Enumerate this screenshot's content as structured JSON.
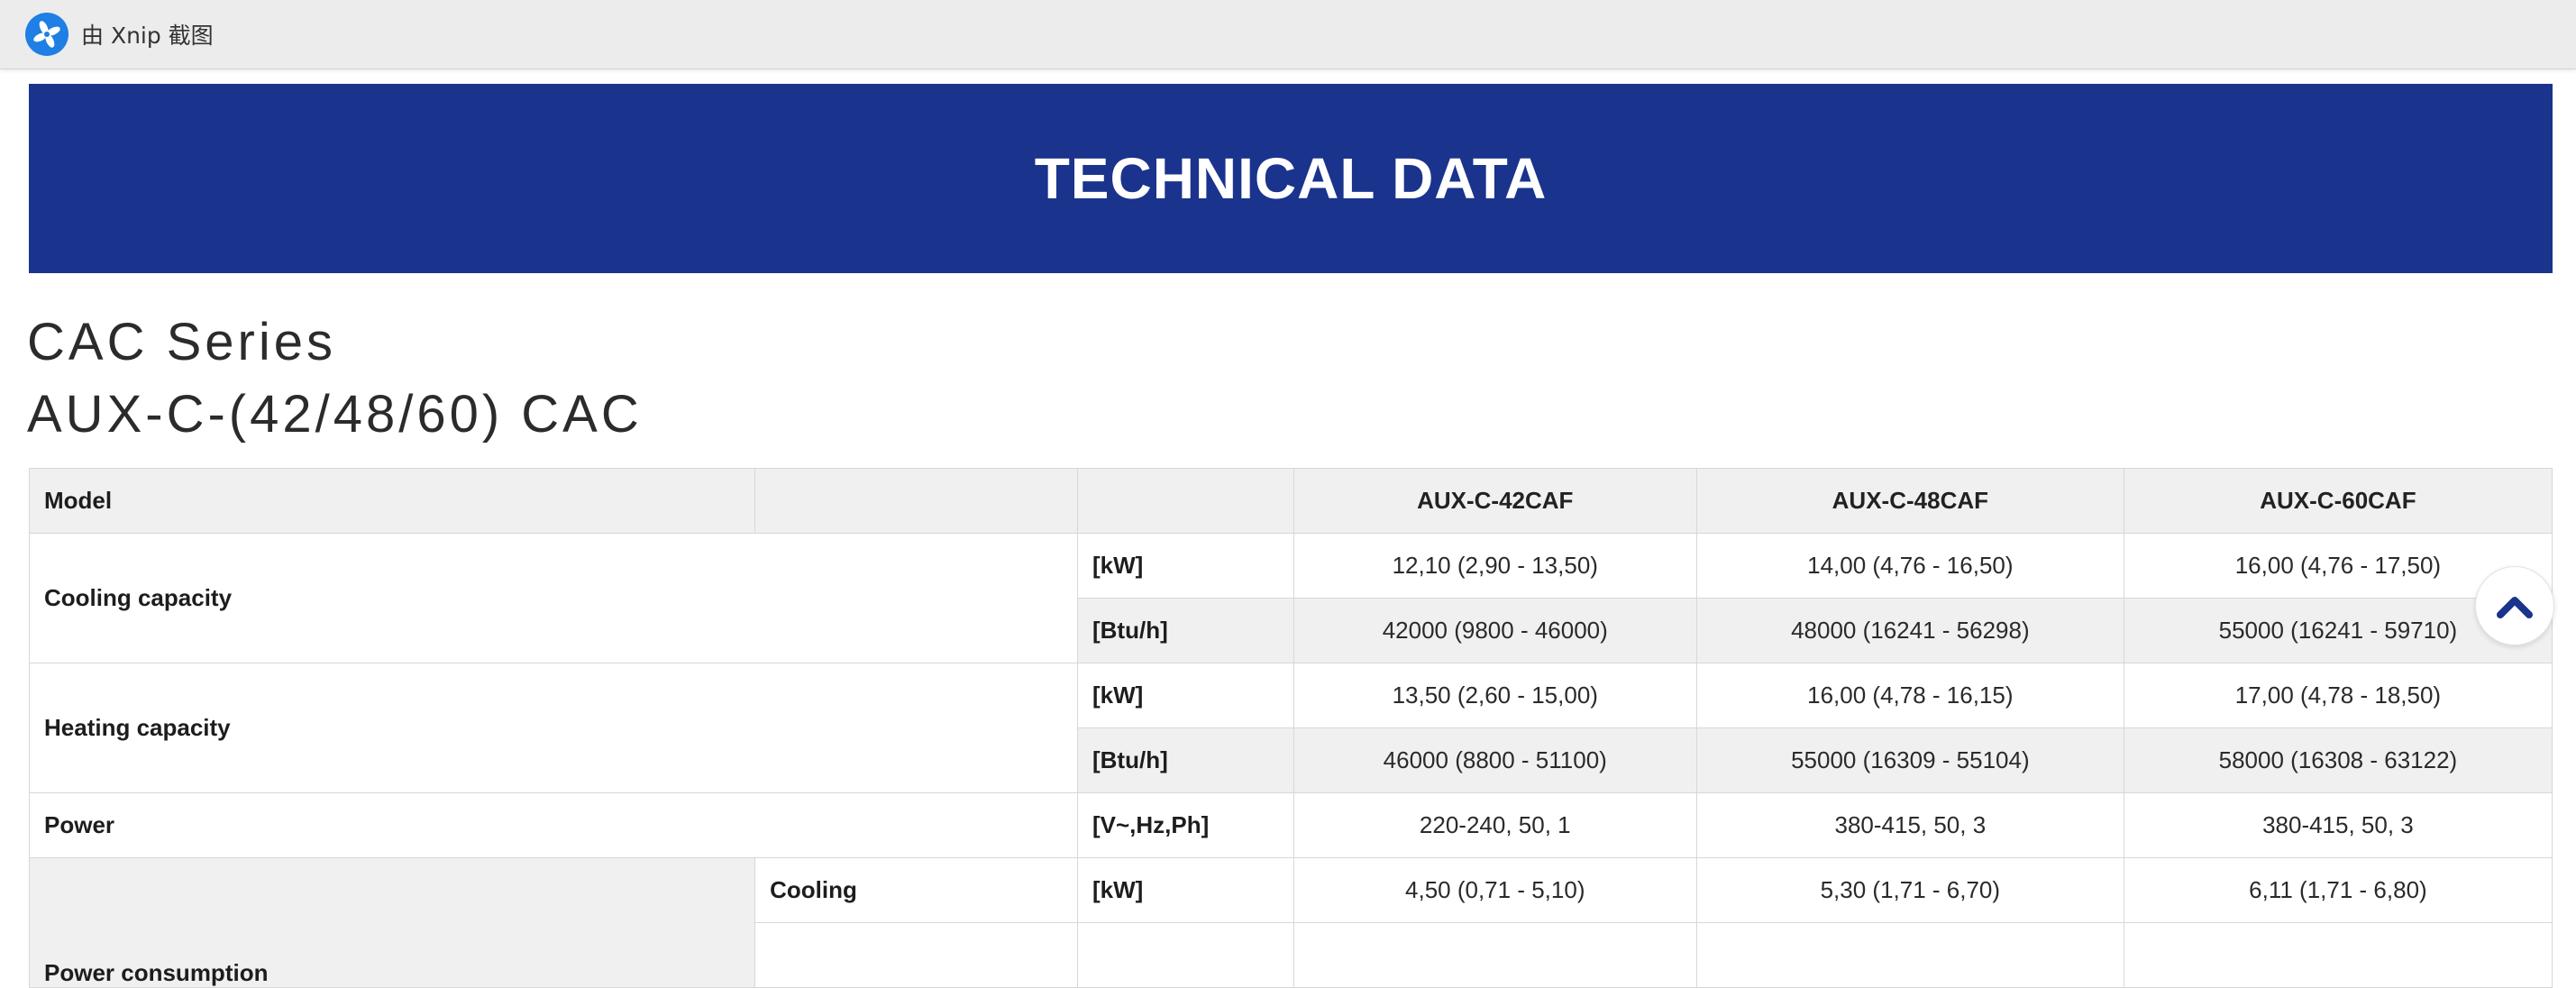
{
  "window": {
    "label": "由 Xnip 截图",
    "icon": "xnip-app-icon"
  },
  "banner": {
    "title": "TECHNICAL DATA",
    "color": "#1a338c"
  },
  "series": {
    "line1": "CAC Series",
    "line2": "AUX-C-(42/48/60) CAC"
  },
  "table": {
    "header": {
      "model_label": "Model",
      "models": [
        "AUX-C-42CAF",
        "AUX-C-48CAF",
        "AUX-C-60CAF"
      ]
    },
    "cooling": {
      "label": "Cooling capacity",
      "rows": [
        {
          "unit": "[kW]",
          "values": [
            "12,10 (2,90 - 13,50)",
            "14,00 (4,76 - 16,50)",
            "16,00 (4,76 - 17,50)"
          ]
        },
        {
          "unit": "[Btu/h]",
          "values": [
            "42000 (9800 - 46000)",
            "48000 (16241 - 56298)",
            "55000 (16241 - 59710)"
          ]
        }
      ]
    },
    "heating": {
      "label": "Heating capacity",
      "rows": [
        {
          "unit": "[kW]",
          "values": [
            "13,50 (2,60 - 15,00)",
            "16,00 (4,78 - 16,15)",
            "17,00 (4,78 - 18,50)"
          ]
        },
        {
          "unit": "[Btu/h]",
          "values": [
            "46000 (8800 - 51100)",
            "55000 (16309 - 55104)",
            "58000 (16308 - 63122)"
          ]
        }
      ]
    },
    "power": {
      "label": "Power",
      "unit": "[V~,Hz,Ph]",
      "values": [
        "220-240, 50, 1",
        "380-415, 50, 3",
        "380-415, 50, 3"
      ]
    },
    "power_consumption": {
      "label": "Power consumption",
      "sub_label": "Cooling",
      "unit": "[kW]",
      "values": [
        "4,50 (0,71 - 5,10)",
        "5,30 (1,71 - 6,70)",
        "6,11 (1,71 - 6,80)"
      ]
    }
  },
  "scroll_top": {
    "icon": "chevron-up-icon",
    "color": "#1a338c"
  }
}
